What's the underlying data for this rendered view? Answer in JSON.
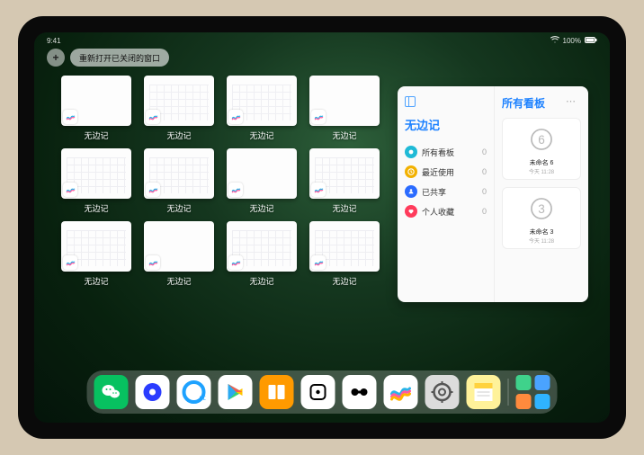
{
  "status": {
    "time": "9:41",
    "battery": "100%"
  },
  "controls": {
    "add": "+",
    "reopen": "重新打开已关闭的窗口"
  },
  "app_name": "无边记",
  "windows": [
    {
      "label": "无边记",
      "variant": "blank"
    },
    {
      "label": "无边记",
      "variant": "cal"
    },
    {
      "label": "无边记",
      "variant": "cal"
    },
    {
      "label": "无边记",
      "variant": "blank"
    },
    {
      "label": "无边记",
      "variant": "cal"
    },
    {
      "label": "无边记",
      "variant": "cal"
    },
    {
      "label": "无边记",
      "variant": "blank"
    },
    {
      "label": "无边记",
      "variant": "cal"
    },
    {
      "label": "无边记",
      "variant": "cal"
    },
    {
      "label": "无边记",
      "variant": "blank"
    },
    {
      "label": "无边记",
      "variant": "cal"
    },
    {
      "label": "无边记",
      "variant": "cal"
    }
  ],
  "panel": {
    "title": "无边记",
    "categories": [
      {
        "label": "所有看板",
        "count": "0",
        "color": "#1fbad6"
      },
      {
        "label": "最近使用",
        "count": "0",
        "color": "#f2b100"
      },
      {
        "label": "已共享",
        "count": "0",
        "color": "#2a6bff"
      },
      {
        "label": "个人收藏",
        "count": "0",
        "color": "#ff3b5b"
      }
    ],
    "right_title": "所有看板",
    "boards": [
      {
        "name": "未命名 6",
        "meta": "今天 11:28",
        "digit": "6"
      },
      {
        "name": "未命名 3",
        "meta": "今天 11:28",
        "digit": "3"
      }
    ]
  },
  "dock": [
    {
      "name": "wechat",
      "bg": "#07c160"
    },
    {
      "name": "quark",
      "bg": "#ffffff"
    },
    {
      "name": "browser",
      "bg": "#ffffff"
    },
    {
      "name": "play",
      "bg": "#ffffff"
    },
    {
      "name": "books",
      "bg": "#ff9a00"
    },
    {
      "name": "dice",
      "bg": "#ffffff"
    },
    {
      "name": "connect",
      "bg": "#ffffff"
    },
    {
      "name": "freeform",
      "bg": "#ffffff"
    },
    {
      "name": "settings",
      "bg": "#dcdcdc"
    },
    {
      "name": "notes",
      "bg": "#fff29a"
    }
  ]
}
